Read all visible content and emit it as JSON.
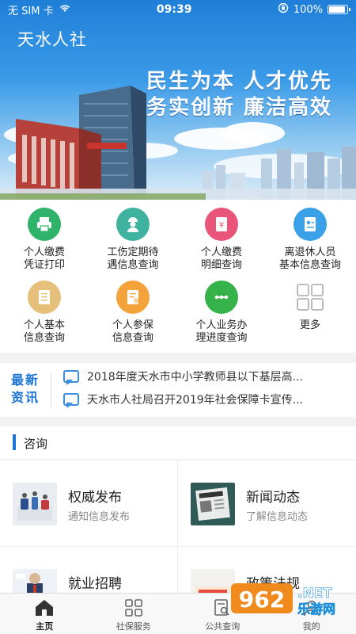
{
  "status_bar": {
    "carrier": "无 SIM 卡",
    "time": "09:39",
    "battery": "100%",
    "battery_level": 1.0
  },
  "header": {
    "title": "天水人社"
  },
  "banner": {
    "slogan_line1": "民生为本 人才优先",
    "slogan_line2": "务实创新 廉洁高效"
  },
  "services": [
    {
      "label": "个人缴费\n凭证打印",
      "icon": "printer-icon",
      "color": "#2fb36a"
    },
    {
      "label": "工伤定期待\n遇信息查询",
      "icon": "worker-icon",
      "color": "#3fb3a0"
    },
    {
      "label": "个人缴费\n明细查询",
      "icon": "bill-icon",
      "color": "#e9557a"
    },
    {
      "label": "离退休人员\n基本信息查询",
      "icon": "id-card-icon",
      "color": "#3aa0e8"
    },
    {
      "label": "个人基本\n信息查询",
      "icon": "profile-card-icon",
      "color": "#e5c07b"
    },
    {
      "label": "个人参保\n信息查询",
      "icon": "insurance-doc-icon",
      "color": "#f4a23a"
    },
    {
      "label": "个人业务办\n理进度查询",
      "icon": "progress-icon",
      "color": "#35b34a"
    },
    {
      "label": "更多",
      "icon": "more-grid-icon",
      "color": "#bbbbbb"
    }
  ],
  "news": {
    "tag_line1": "最新",
    "tag_line2": "资讯",
    "items": [
      "2018年度天水市中小学教师县以下基层高...",
      "天水市人社局召开2019年社会保障卡宣传..."
    ]
  },
  "consult": {
    "title": "咨询",
    "cards": [
      {
        "title": "权威发布",
        "subtitle": "通知信息发布"
      },
      {
        "title": "新闻动态",
        "subtitle": "了解信息动态"
      },
      {
        "title": "就业招聘",
        "subtitle": ""
      },
      {
        "title": "政策法规",
        "subtitle": ""
      }
    ]
  },
  "tabbar": {
    "tabs": [
      {
        "label": "主页",
        "icon": "home-icon"
      },
      {
        "label": "社保服务",
        "icon": "grid-icon"
      },
      {
        "label": "公共查询",
        "icon": "search-doc-icon"
      },
      {
        "label": "我的",
        "icon": "user-icon"
      }
    ]
  },
  "watermark": {
    "text": "962 NET 乐游网"
  },
  "colors": {
    "primary": "#1b73d2",
    "tab_active": "#222222"
  }
}
